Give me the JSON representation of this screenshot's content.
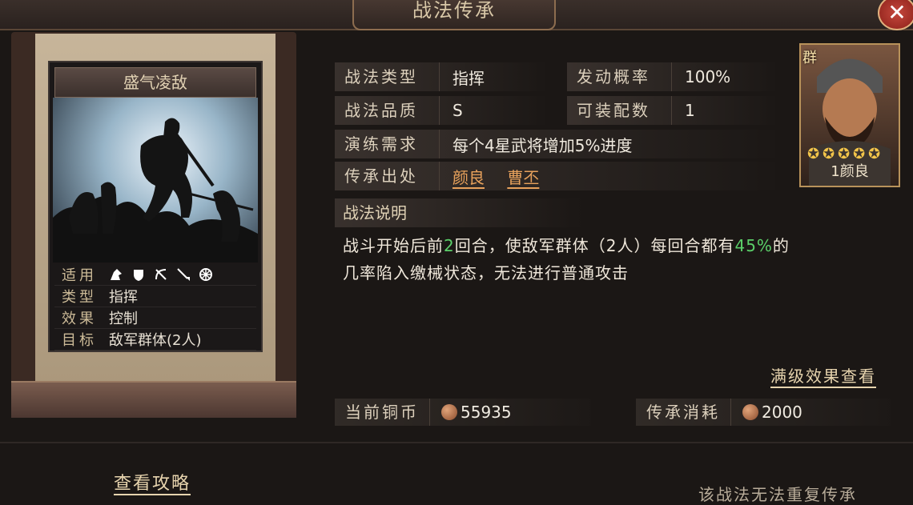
{
  "window": {
    "title": "战法传承",
    "close_label": "✕"
  },
  "skill_card": {
    "name": "盛气凌敌",
    "meta": [
      {
        "key": "适用",
        "value": ""
      },
      {
        "key": "类型",
        "value": "指挥"
      },
      {
        "key": "效果",
        "value": "控制"
      },
      {
        "key": "目标",
        "value": "敌军群体(2人)"
      }
    ],
    "unit_type_icons": [
      "cavalry-icon",
      "shield-icon",
      "bow-icon",
      "spear-icon",
      "wheel-icon"
    ]
  },
  "attributes": {
    "type_label": "战法类型",
    "type_value": "指挥",
    "chance_label": "发动概率",
    "chance_value": "100%",
    "quality_label": "战法品质",
    "quality_value": "S",
    "equip_label": "可装配数",
    "equip_value": "1",
    "train_label": "演练需求",
    "train_value": "每个4星武将增加5%进度",
    "origin_label": "传承出处",
    "origins": [
      "颜良",
      "曹丕"
    ]
  },
  "portrait": {
    "faction": "群",
    "stars": 5,
    "name": "1颜良"
  },
  "description": {
    "title": "战法说明",
    "part1": "战斗开始后前",
    "rounds": "2",
    "part2": "回合，使敌军群体（2人）每回合都有",
    "percent": "45%",
    "part3": "的",
    "line2": "几率陷入缴械状态，无法进行普通攻击"
  },
  "full_effect_link": "满级效果查看",
  "costs": {
    "current_label": "当前铜币",
    "current_value": "55935",
    "consume_label": "传承消耗",
    "consume_value": "2000"
  },
  "guide_link": "查看攻略",
  "notice": "该战法无法重复传承"
}
